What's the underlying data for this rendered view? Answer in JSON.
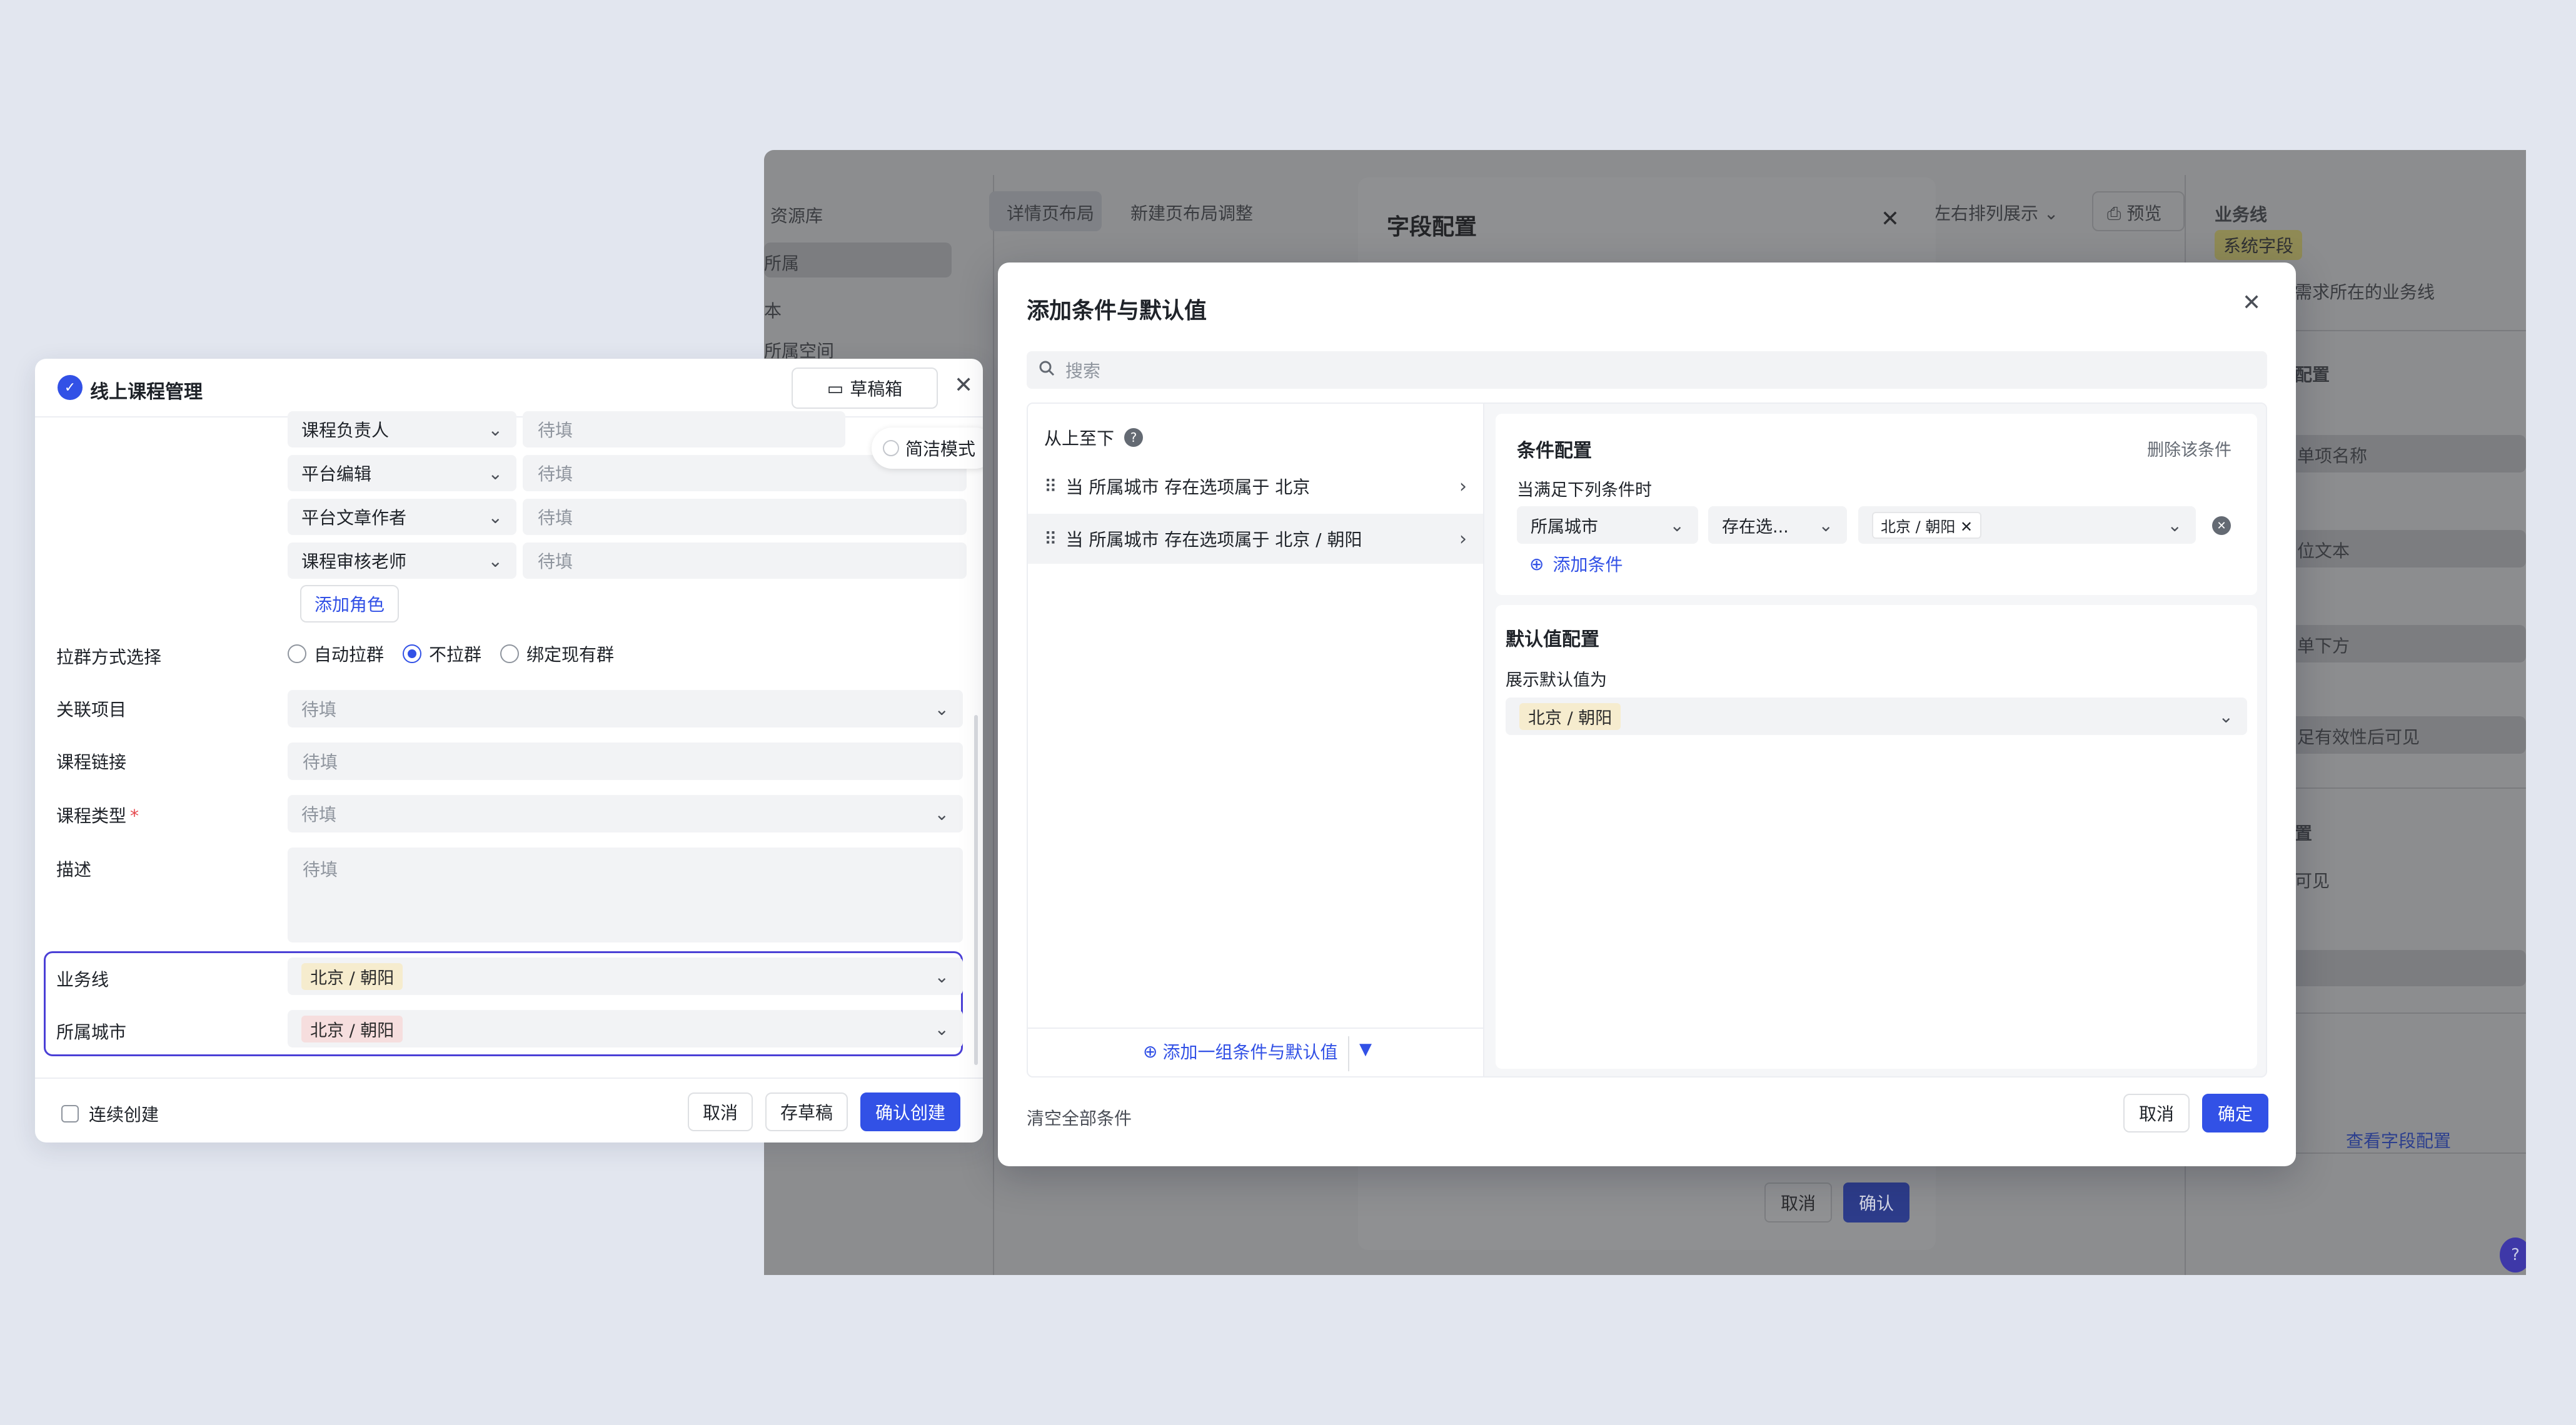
{
  "background_app": {
    "sidebar_items": [
      "资源库",
      "所属",
      "本",
      "所属空间"
    ],
    "tabs": [
      "详情页布局",
      "新建页布局调整"
    ],
    "toolbar": {
      "layout_label": "左右排列展示",
      "preview_label": "预览"
    },
    "right_panel": {
      "title": "业务线",
      "badge": "系统字段",
      "desc": "需求所在的业务线",
      "section_1": "配置",
      "placeholder_1": "单项名称",
      "placeholder_2": "位文本",
      "placeholder_3": "单下方",
      "visibility_text": "足有效性后可见",
      "section_2": "置",
      "visible_text": "可见",
      "view_config_link": "查看字段配置"
    }
  },
  "field_config_modal": {
    "title": "字段配置",
    "cancel_label": "取消",
    "confirm_label": "确认"
  },
  "form_panel": {
    "title": "线上课程管理",
    "draft_box_label": "草稿箱",
    "clean_mode_label": "简洁模式",
    "roles": [
      {
        "role": "课程负责人",
        "placeholder": "待填"
      },
      {
        "role": "平台编辑",
        "placeholder": "待填"
      },
      {
        "role": "平台文章作者",
        "placeholder": "待填"
      },
      {
        "role": "课程审核老师",
        "placeholder": "待填"
      }
    ],
    "add_role_label": "添加角色",
    "group_method": {
      "label": "拉群方式选择",
      "options": [
        "自动拉群",
        "不拉群",
        "绑定现有群"
      ],
      "selected": "不拉群"
    },
    "related_project": {
      "label": "关联项目",
      "placeholder": "待填"
    },
    "course_link": {
      "label": "课程链接",
      "placeholder": "待填"
    },
    "course_type": {
      "label": "课程类型",
      "required_mark": "*",
      "placeholder": "待填"
    },
    "description": {
      "label": "描述",
      "placeholder": "待填"
    },
    "business_line": {
      "label": "业务线",
      "value": "北京 / 朝阳"
    },
    "city": {
      "label": "所属城市",
      "value": "北京 / 朝阳"
    },
    "footer": {
      "continuous_create_label": "连续创建",
      "cancel_label": "取消",
      "save_draft_label": "存草稿",
      "confirm_create_label": "确认创建"
    }
  },
  "condition_dialog": {
    "title": "添加条件与默认值",
    "search_placeholder": "搜索",
    "order_label": "从上至下",
    "rules": [
      {
        "prefix": "当",
        "field": "所属城市",
        "op": "存在选项属于",
        "value": "北京"
      },
      {
        "prefix": "当",
        "field": "所属城市",
        "op": "存在选项属于",
        "value": "北京 / 朝阳"
      }
    ],
    "add_group_label": "添加一组条件与默认值",
    "condition_config": {
      "title": "条件配置",
      "delete_label": "删除该条件",
      "when_label": "当满足下列条件时",
      "field_select": "所属城市",
      "operator_select": "存在选...",
      "value_tag": "北京 / 朝阳",
      "add_condition_label": "添加条件"
    },
    "default_config": {
      "title": "默认值配置",
      "show_label": "展示默认值为",
      "value": "北京 / 朝阳"
    },
    "clear_all_label": "清空全部条件",
    "cancel_label": "取消",
    "ok_label": "确定"
  }
}
